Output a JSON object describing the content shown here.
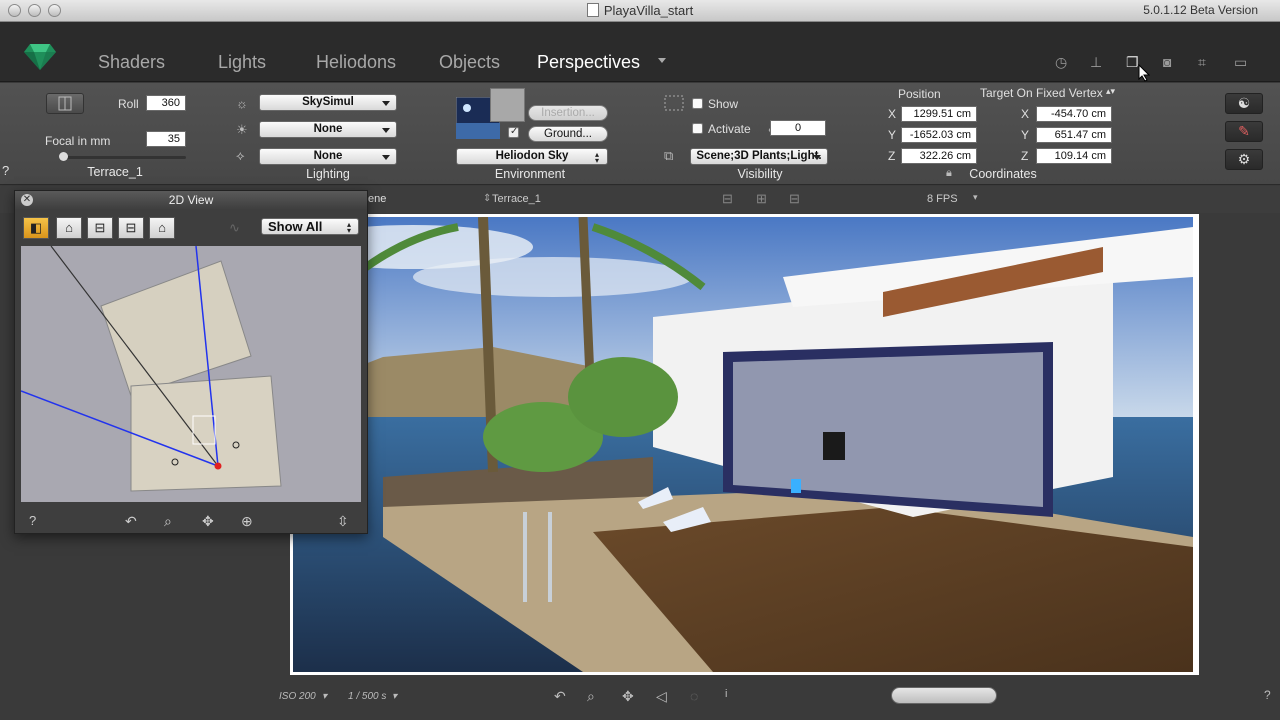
{
  "window": {
    "title": "PlayaVilla_start",
    "version": "5.0.1.12 Beta Version"
  },
  "tabs": [
    {
      "label": "Shaders",
      "active": false
    },
    {
      "label": "Lights",
      "active": false
    },
    {
      "label": "Heliodons",
      "active": false
    },
    {
      "label": "Objects",
      "active": false
    },
    {
      "label": "Perspectives",
      "active": true
    }
  ],
  "camera": {
    "roll_label": "Roll",
    "roll_value": "360",
    "focal_label": "Focal in mm",
    "focal_value": "35",
    "name": "Terrace_1"
  },
  "lighting": {
    "title": "Lighting",
    "sky": "SkySimul",
    "light": "None",
    "shadow": "None"
  },
  "environment": {
    "title": "Environment",
    "insertion_label": "Insertion...",
    "ground_label": "Ground...",
    "heliodon": "Heliodon Sky"
  },
  "visibility": {
    "title": "Visibility",
    "show_label": "Show",
    "activate_label": "Activate",
    "activate_value": "0",
    "layers": "Scene;3D Plants;Light."
  },
  "coordinates": {
    "title": "Coordinates",
    "position_label": "Position",
    "target_label": "Target On Fixed Vertex",
    "pos_x": "1299.51 cm",
    "pos_y": "-1652.03 cm",
    "pos_z": "322.26 cm",
    "tgt_x": "-454.70 cm",
    "tgt_y": "651.47 cm",
    "tgt_z": "109.14 cm",
    "axis_x": "X",
    "axis_y": "Y",
    "axis_z": "Z"
  },
  "subbar": {
    "scene_label": "ene",
    "perspective": "Terrace_1",
    "fps": "8 FPS"
  },
  "panel2d": {
    "title": "2D View",
    "filter": "Show All",
    "help": "?"
  },
  "status": {
    "iso": "ISO 200",
    "shutter": "1 / 500 s"
  },
  "help_mark": "?",
  "colors": {
    "accent_orange": "#e8a82a",
    "gem_green": "#2aa86a",
    "sky_blue": "#6f9fd8",
    "deck_brown": "#7a5a35"
  }
}
